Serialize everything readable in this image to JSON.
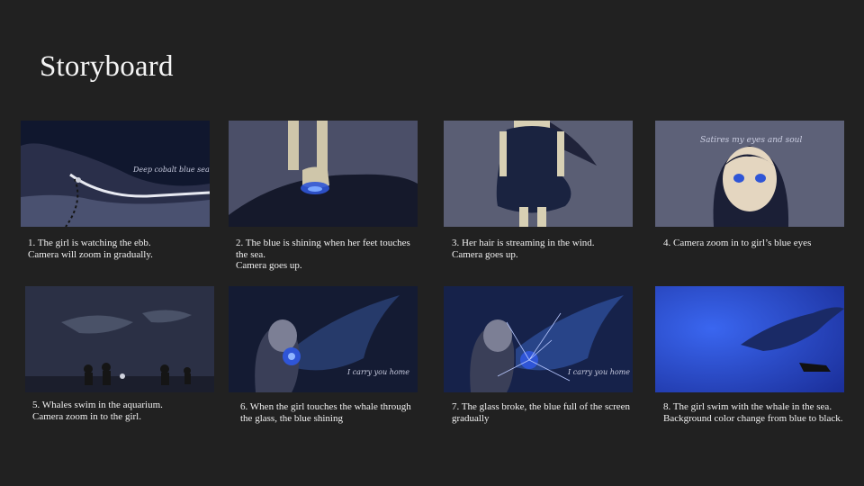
{
  "title": "Storyboard",
  "panels": [
    {
      "caption": "1.  The girl is watching the ebb.\nCamera will zoom in gradually.",
      "overlay": "Deep cobalt blue sea"
    },
    {
      "caption": "2. The blue is shining when her feet touches the sea.\nCamera goes up."
    },
    {
      "caption": "3. Her hair is streaming in the wind.\nCamera goes up."
    },
    {
      "caption": "4. Camera zoom in to girl’s blue eyes",
      "overlay": "Satires my eyes and soul"
    },
    {
      "caption": "5. Whales swim in the aquarium.\nCamera zoom in to the girl."
    },
    {
      "caption": "6. When the girl touches the whale through the glass,  the blue shining",
      "overlay": "I carry you home"
    },
    {
      "caption": "7. The glass broke, the blue full of the screen gradually",
      "overlay": "I carry you home"
    },
    {
      "caption": "8. The girl swim with the whale in the sea. Background color change from blue to black."
    }
  ],
  "colors": {
    "background": "#212121",
    "accent_blue": "#2f55d6"
  }
}
